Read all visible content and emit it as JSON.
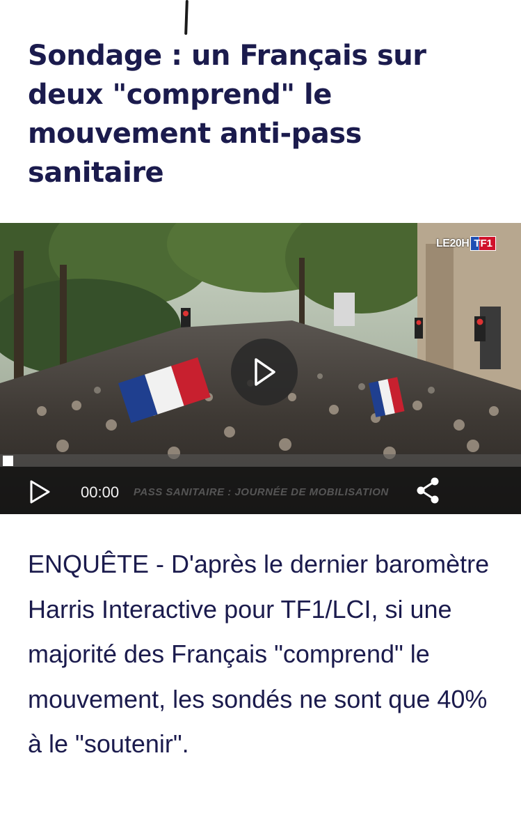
{
  "article": {
    "headline": "Sondage : un Français sur deux \"comprend\" le mouvement anti-pass sanitaire",
    "lede": "ENQUÊTE - D'après le dernier baromètre Harris Interactive pour TF1/LCI, si une majorité des Français \"comprend\" le mouvement, les sondés ne sont que 40% à le \"soutenir\"."
  },
  "video": {
    "logo_program": "LE20H",
    "logo_channel": "TF1",
    "time": "00:00",
    "caption": "PASS SANITAIRE : JOURNÉE DE MOBILISATION",
    "progress": 0,
    "play_icon": "play-icon",
    "share_icon": "share-icon"
  },
  "colors": {
    "headline": "#1b1b4d",
    "body_text": "#1b1b4d",
    "controls_bg": "#141414"
  }
}
